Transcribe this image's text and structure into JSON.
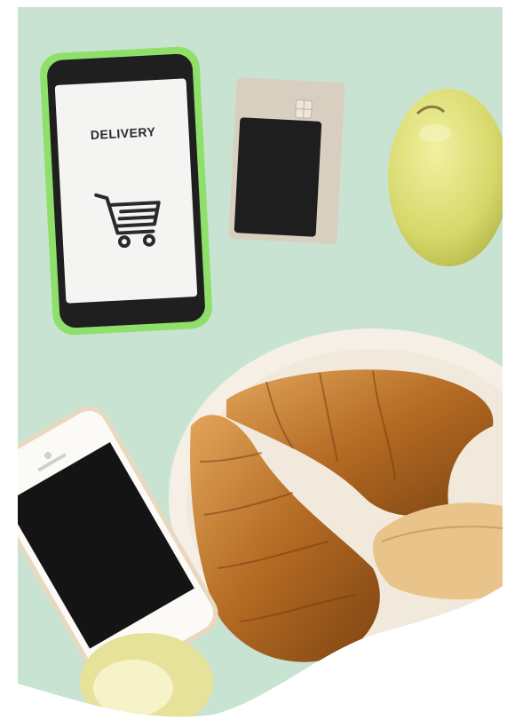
{
  "photo": {
    "phone_screen_text": "DELIVERY",
    "colors": {
      "background": "#c9e3d2",
      "phone_case": "#8fe06a",
      "card": "#d9cfc0",
      "apple": "#dfe07a",
      "croissant": "#b9752c",
      "plate": "#f5efe6"
    },
    "icons": [
      "shopping-cart-icon",
      "sim-chip-icon"
    ]
  }
}
